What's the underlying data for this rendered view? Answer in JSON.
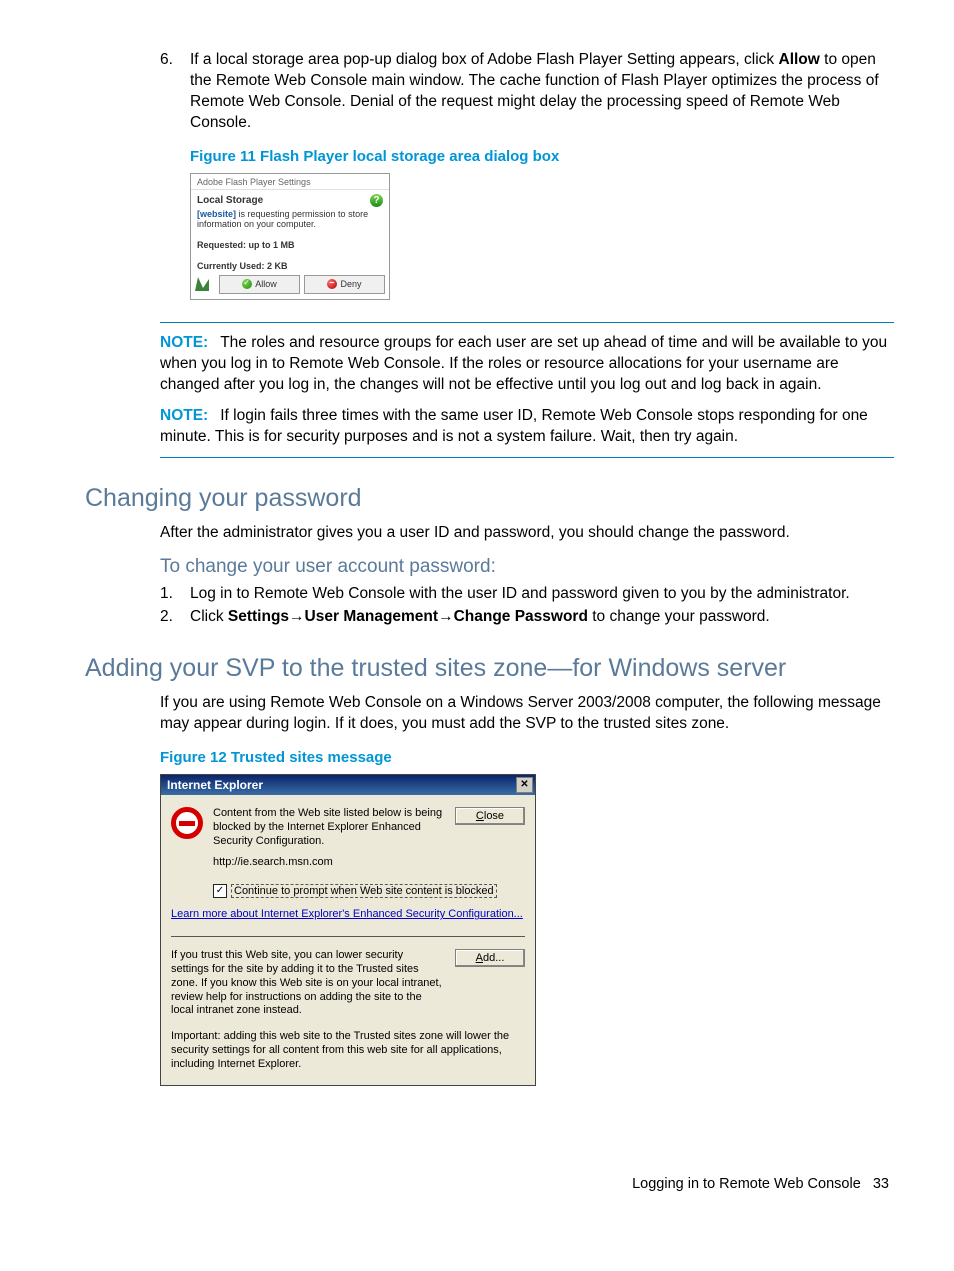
{
  "step6": {
    "number": "6.",
    "text_pre": "If a local storage area pop-up dialog box of Adobe Flash Player Setting appears, click ",
    "allow": "Allow",
    "text_post": " to open the Remote Web Console main window. The cache function of Flash Player optimizes the process of Remote Web Console. Denial of the request might delay the processing speed of Remote Web Console."
  },
  "figure11_caption": "Figure 11 Flash Player local storage area dialog box",
  "flash": {
    "title": "Adobe Flash Player Settings",
    "subtitle": "Local Storage",
    "website_label": "[website]",
    "request_text": " is requesting permission to store information on your computer.",
    "requested": "Requested: up to 1 MB",
    "used": "Currently Used: 2 KB",
    "allow_label": "Allow",
    "deny_label": "Deny"
  },
  "note1": {
    "label": "NOTE:",
    "text": "The roles and resource groups for each user are set up ahead of time and will be available to you when you log in to Remote Web Console. If the roles or resource allocations for your username are changed after you log in, the changes will not be effective until you log out and log back in again."
  },
  "note2": {
    "label": "NOTE:",
    "text": "If login fails three times with the same user ID, Remote Web Console stops responding for one minute. This is for security purposes and is not a system failure. Wait, then try again."
  },
  "section_change_pw": {
    "heading": "Changing your password",
    "intro": "After the administrator gives you a user ID and password, you should change the password.",
    "sub": "To change your user account password:",
    "step1_num": "1.",
    "step1": "Log in to Remote Web Console with the user ID and password given to you by the administrator.",
    "step2_num": "2.",
    "step2_pre": "Click ",
    "step2_b1": "Settings",
    "step2_arrow1": "→",
    "step2_b2": "User Management",
    "step2_arrow2": "→",
    "step2_b3": "Change Password",
    "step2_post": " to change your password."
  },
  "section_svp": {
    "heading": "Adding your SVP to the trusted sites zone—for Windows server",
    "intro": "If you are using Remote Web Console on a Windows Server 2003/2008 computer, the following message may appear during login. If it does, you must add the SVP to the trusted sites zone."
  },
  "figure12_caption": "Figure 12 Trusted sites message",
  "ie": {
    "title": "Internet Explorer",
    "msg": "Content from the Web site listed below is being blocked by the Internet Explorer Enhanced Security Configuration.",
    "close_label_u": "C",
    "close_label_rest": "lose",
    "url": "http://ie.search.msn.com",
    "check_label": "Continue to prompt when Web site content is blocked",
    "learn_more": "Learn more about Internet Explorer's Enhanced Security Configuration...",
    "lower_text": "If you trust this Web site, you can lower security settings for the site by adding it to the Trusted sites zone. If you know this Web site is on your local intranet, review help for instructions on adding the site to the local intranet zone instead.",
    "add_label_u": "A",
    "add_label_rest": "dd...",
    "important": "Important: adding this web site to the Trusted sites zone will lower the security settings for all content from this web site for all applications, including Internet Explorer."
  },
  "footer": {
    "text": "Logging in to Remote Web Console",
    "page": "33"
  }
}
